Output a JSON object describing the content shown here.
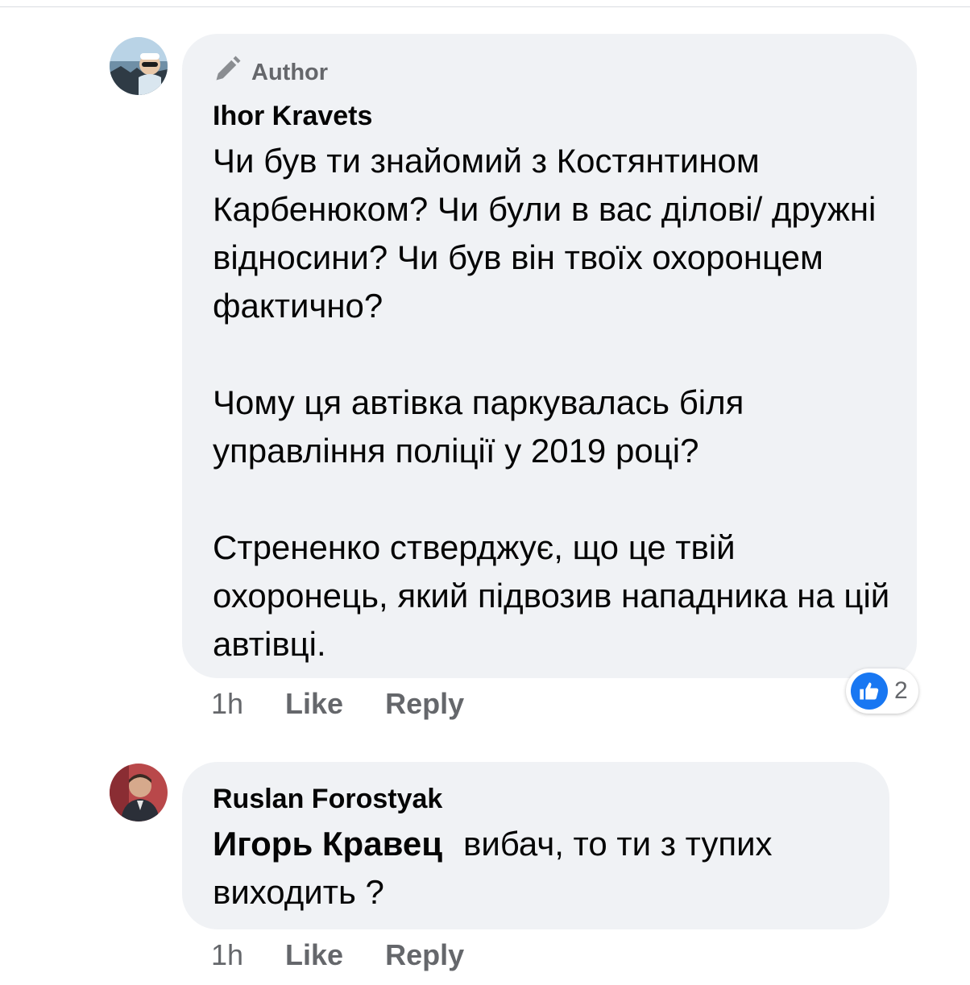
{
  "comments": [
    {
      "badge": "Author",
      "author": "Ihor Kravets",
      "paragraphs": [
        "Чи був ти знайомий з Костянтином Карбенюком? Чи були в вас ділові/ дружні відносини? Чи був він твоїх охоронцем фактично?",
        "Чому ця автівка паркувалась біля управління поліції у 2019 році?",
        "Стрененко стверджує, що це твій охоронець, який підвозив нападника на цій автівці."
      ],
      "time": "1h",
      "like_label": "Like",
      "reply_label": "Reply",
      "reaction_count": "2",
      "reaction_icon": "like-thumb"
    },
    {
      "author": "Ruslan Forostyak",
      "mention": "Игорь Кравец",
      "text_line1": "вибач, то ти з тупих",
      "text_line2": "виходить ?",
      "time": "1h",
      "like_label": "Like",
      "reply_label": "Reply"
    }
  ],
  "colors": {
    "bubble": "#f0f2f5",
    "secondary_text": "#65676b",
    "like_blue": "#1877f2"
  }
}
